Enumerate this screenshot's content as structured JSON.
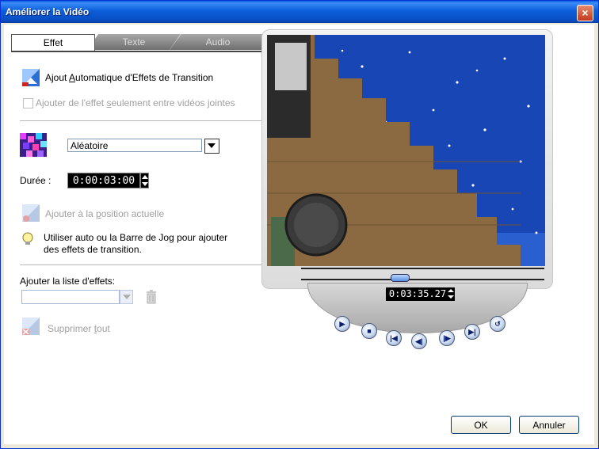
{
  "window": {
    "title": "Améliorer la Vidéo",
    "close_symbol": "×"
  },
  "tabs": {
    "effet": "Effet",
    "texte": "Texte",
    "audio": "Audio"
  },
  "auto_transition": {
    "label_pre": "Ajout ",
    "label_accel": "A",
    "label_post": "utomatique d'Effets de Transition",
    "icon": "transition-effect-icon"
  },
  "join_only": {
    "label_pre": "Ajouter de l'effet ",
    "label_accel": "s",
    "label_post": "eulement entre vidéos jointes",
    "checked": false
  },
  "effect_select": {
    "value": "Aléatoire",
    "icon": "random-effect-icon"
  },
  "duration": {
    "label": "Durée :",
    "value": "0:00:03:00"
  },
  "add_position": {
    "label_pre": "Ajouter à la ",
    "label_accel": "p",
    "label_post": "osition actuelle",
    "icon": "add-transition-icon"
  },
  "hint": {
    "line1": "Utiliser auto ou la Barre de Jog pour ajouter",
    "line2": "des effets de transition.",
    "icon": "lightbulb-icon"
  },
  "effects_list": {
    "label": "Ajouter la liste d'effets:",
    "value": "",
    "trash_icon": "trash-icon"
  },
  "delete_all": {
    "label_pre": "Supprimer ",
    "label_accel": "t",
    "label_post": "out",
    "icon": "delete-all-icon"
  },
  "player": {
    "timecode": "0:03:35.27",
    "buttons": [
      "play-icon",
      "stop-icon",
      "go-start-icon",
      "prev-frame-icon",
      "next-frame-icon",
      "go-end-icon",
      "repeat-icon"
    ]
  },
  "footer": {
    "ok": "OK",
    "cancel": "Annuler"
  }
}
